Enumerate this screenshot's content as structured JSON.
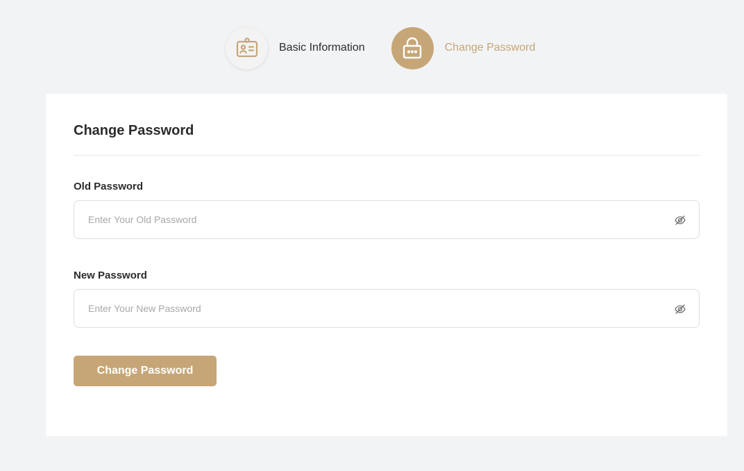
{
  "colors": {
    "accent": "#c6a677",
    "background": "#f2f3f5",
    "card": "#ffffff",
    "text": "#2b2b2b",
    "placeholder": "#a8a8a8"
  },
  "stepper": {
    "steps": [
      {
        "label": "Basic Information",
        "icon": "id-card-icon",
        "state": "inactive"
      },
      {
        "label": "Change Password",
        "icon": "lock-icon",
        "state": "active"
      }
    ]
  },
  "form": {
    "title": "Change Password",
    "old_password": {
      "label": "Old Password",
      "placeholder": "Enter Your Old Password",
      "value": "",
      "toggle_icon": "eye-slash-icon"
    },
    "new_password": {
      "label": "New Password",
      "placeholder": "Enter Your New Password",
      "value": "",
      "toggle_icon": "eye-slash-icon"
    },
    "submit_label": "Change Password"
  }
}
